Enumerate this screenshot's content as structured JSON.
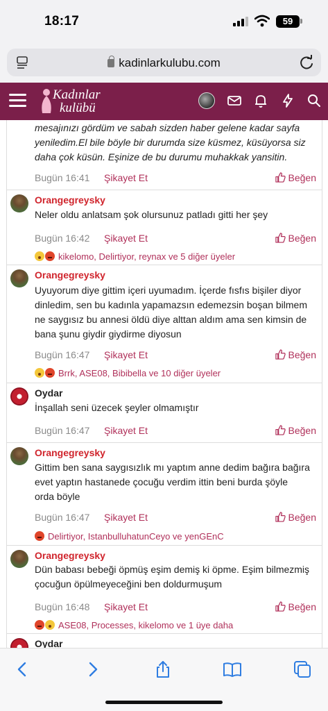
{
  "status_bar": {
    "time": "18:17",
    "battery": "59"
  },
  "browser": {
    "url": "kadinlarkulubu.com"
  },
  "site": {
    "logo_text_line1": "Kadınlar",
    "logo_text_line2": "kulübü"
  },
  "posts": [
    {
      "author": "",
      "lines": [
        "mesajınızı gördüm ve sabah sizden haber gelene kadar sayfa",
        "yeniledim.El bile böyle bir durumda size küsmez, küsüyorsa siz",
        "daha çok küsün. Eşinize de bu durumu muhakkak yansitin."
      ],
      "time": "Bugün 16:41",
      "report": "Şikayet Et",
      "like": "Beğen",
      "reactions": ""
    },
    {
      "author": "Orangegreysky",
      "lines": [
        "Neler oldu anlatsam şok olursunuz patladı gitti her şey"
      ],
      "time": "Bugün 16:42",
      "report": "Şikayet Et",
      "like": "Beğen",
      "reactions": "kikelomo, Delirtiyor, reynax ve 5 diğer üyeler"
    },
    {
      "author": "Orangegreysky",
      "lines": [
        "Uyuyorum diye gittim içeri uyumadım. İçerde fısfıs bişiler diyor",
        "dinledim, sen bu kadınla yapamazsın edemezsin boşan bilmem",
        "ne saygısız bu annesi öldü diye alttan aldım ama sen kimsin de",
        "bana şunu giydir giydirme diyosun"
      ],
      "time": "Bugün 16:47",
      "report": "Şikayet Et",
      "like": "Beğen",
      "reactions": "Brrk, ASE08, Bibibella ve 10 diğer üyeler"
    },
    {
      "author": "Oydar",
      "lines": [
        "İnşallah seni üzecek şeyler olmamıştır"
      ],
      "time": "Bugün 16:47",
      "report": "Şikayet Et",
      "like": "Beğen",
      "reactions": ""
    },
    {
      "author": "Orangegreysky",
      "lines": [
        "Gittim ben sana saygısızlık mı yaptım anne dedim bağıra bağıra",
        "evet yaptın hastanede çocuğu verdim ittin beni burda şöyle",
        "orda böyle"
      ],
      "time": "Bugün 16:47",
      "report": "Şikayet Et",
      "like": "Beğen",
      "reactions": "Delirtiyor, IstanbulluhatunCeyo ve yenGEnC"
    },
    {
      "author": "Orangegreysky",
      "lines": [
        "Dün babası bebeği öpmüş eşim demiş ki öpme. Eşim bilmezmiş",
        "çocuğun öpülmeyeceğini ben doldurmuşum"
      ],
      "time": "Bugün 16:48",
      "report": "Şikayet Et",
      "like": "Beğen",
      "reactions": "ASE08, Processes, kikelomo ve 1 üye daha"
    },
    {
      "author": "Oydar",
      "lines": [],
      "time": "",
      "report": "",
      "like": "",
      "reactions": ""
    }
  ]
}
